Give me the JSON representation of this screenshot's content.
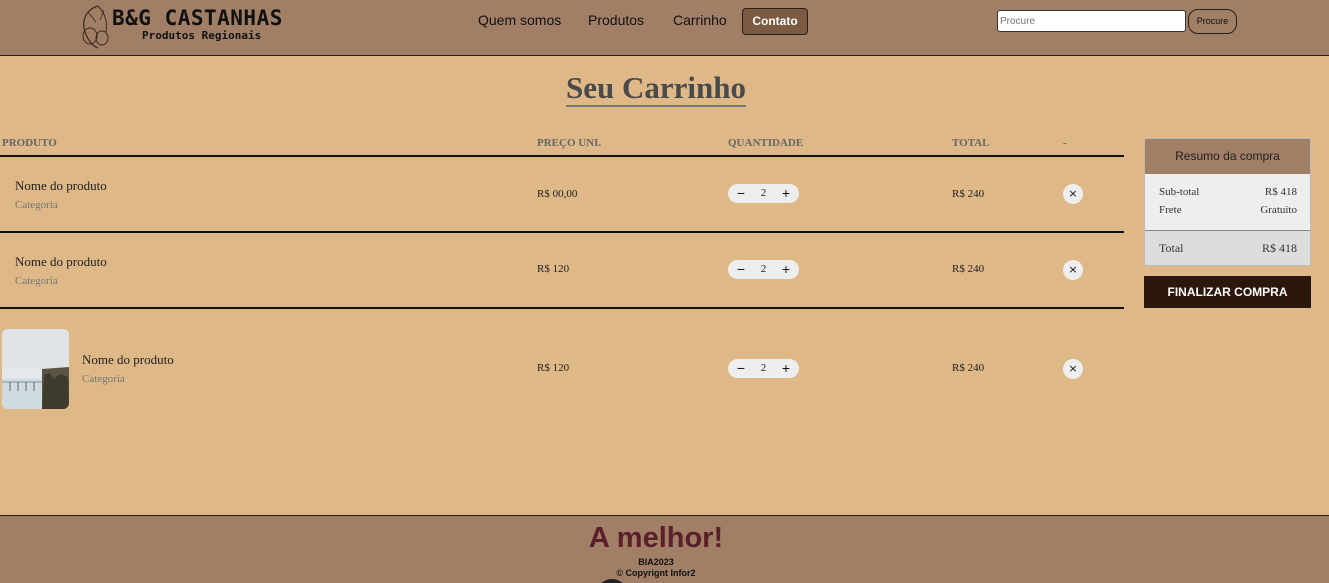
{
  "header": {
    "logo_title": "B&G CASTANHAS",
    "logo_subtitle": "Produtos Regionais",
    "nav": [
      "Quem somos",
      "Produtos",
      "Carrinho"
    ],
    "contact_label": "Contato",
    "search_placeholder": "Procure",
    "search_button": "Procure"
  },
  "page_title": "Seu Carrinho",
  "table": {
    "headers": [
      "PRODUTO",
      "PREÇO UNI.",
      "QUANTIDADE",
      "TOTAL",
      "-"
    ],
    "rows": [
      {
        "name": "Nome do produto",
        "category": "Categoria",
        "price": "R$ 00,00",
        "quantity": "2",
        "total": "R$ 240",
        "has_image": false
      },
      {
        "name": "Nome do produto",
        "category": "Categoria",
        "price": "R$ 120",
        "quantity": "2",
        "total": "R$ 240",
        "has_image": false
      },
      {
        "name": "Nome do produto",
        "category": "Categoria",
        "price": "R$ 120",
        "quantity": "2",
        "total": "R$ 240",
        "has_image": true
      }
    ],
    "qty_minus": "−",
    "qty_plus": "+",
    "remove_symbol": "×"
  },
  "summary": {
    "title": "Resumo da compra",
    "subtotal_label": "Sub-total",
    "subtotal_value": "R$ 418",
    "shipping_label": "Frete",
    "shipping_value": "Gratuito",
    "total_label": "Total",
    "total_value": "R$ 418",
    "checkout_button": "FINALIZAR COMPRA"
  },
  "footer": {
    "title": "A melhor!",
    "line1": "BIA2023",
    "line2": "© Copyrignt Infor2"
  },
  "colors": {
    "page_bg": "#deb887",
    "header_bg": "#a07f66",
    "footer_title": "#5a1f2a",
    "checkout_bg": "#2b170b"
  }
}
